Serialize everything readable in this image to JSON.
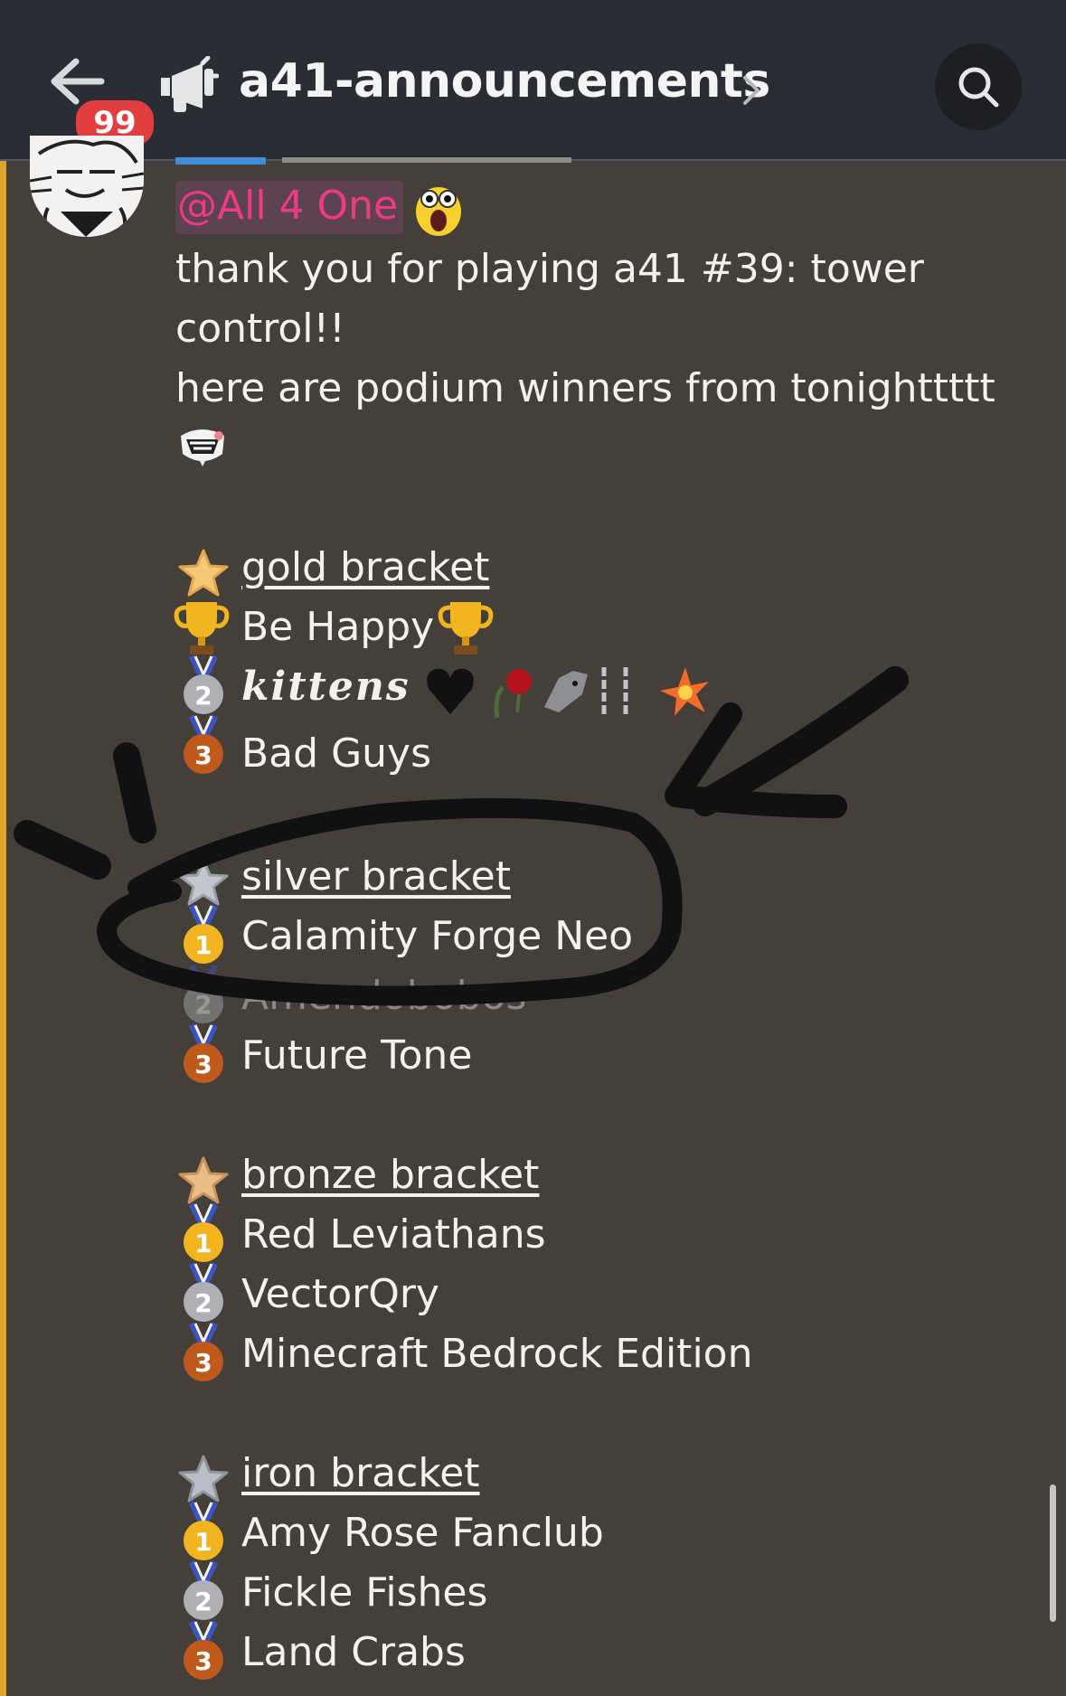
{
  "header": {
    "unread_count": "99",
    "channel_name": "a41-announcements"
  },
  "message": {
    "mention": "@All 4 One",
    "body": [
      "thank you for playing a41 #39: tower",
      "control!!",
      "here are podium winners from tonighttttt"
    ],
    "brackets": [
      {
        "title": "gold bracket",
        "placements": [
          {
            "rank": "1",
            "team": "Be Happy"
          },
          {
            "rank": "2",
            "team": "𝒌𝒊𝒕𝒕𝒆𝒏𝒔"
          },
          {
            "rank": "3",
            "team": "Bad Guys"
          }
        ]
      },
      {
        "title": "silver bracket",
        "placements": [
          {
            "rank": "1",
            "team": "Calamity Forge Neo"
          },
          {
            "rank": "2",
            "team": "Amendobobos"
          },
          {
            "rank": "3",
            "team": "Future Tone"
          }
        ]
      },
      {
        "title": "bronze bracket",
        "placements": [
          {
            "rank": "1",
            "team": "Red Leviathans"
          },
          {
            "rank": "2",
            "team": "VectorQry"
          },
          {
            "rank": "3",
            "team": "Minecraft Bedrock Edition"
          }
        ]
      },
      {
        "title": "iron bracket",
        "placements": [
          {
            "rank": "1",
            "team": "Amy Rose Fanclub"
          },
          {
            "rank": "2",
            "team": "Fickle Fishes"
          },
          {
            "rank": "3",
            "team": "Land Crabs"
          }
        ]
      }
    ]
  },
  "icons": {
    "back": "back-arrow-icon",
    "channel": "announcement-megaphone-icon",
    "search": "search-icon",
    "trophy": "trophy-icon",
    "medals": [
      "first-place-medal-icon",
      "second-place-medal-icon",
      "third-place-medal-icon"
    ],
    "bracket_stars": [
      "gold-star-icon",
      "silver-star-icon",
      "bronze-star-icon",
      "iron-star-icon"
    ]
  },
  "colors": {
    "header_bg": "#2a2d33",
    "chat_bg": "#443f39",
    "mention_text": "#ec3b7f",
    "mention_bg": "#5d4351",
    "unread_badge": "#e23d3f",
    "mention_bar": "#e2a32b"
  }
}
